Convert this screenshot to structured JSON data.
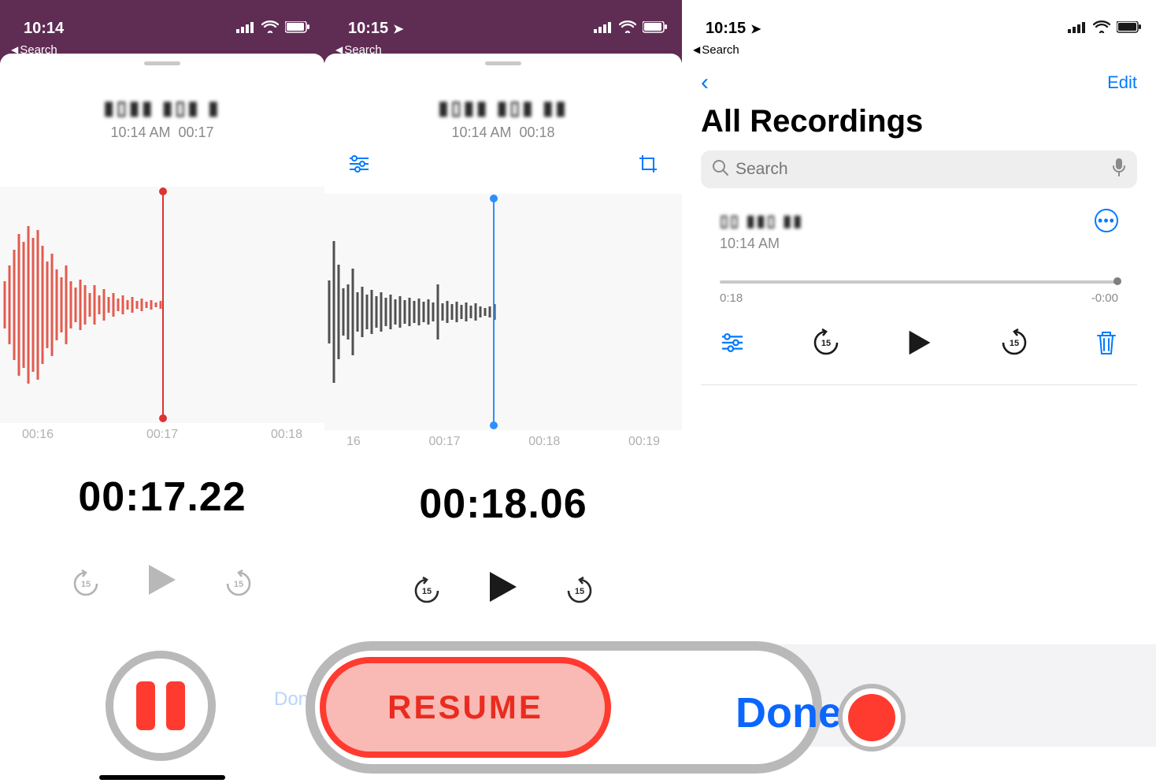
{
  "screen1": {
    "statusbar": {
      "time": "10:14"
    },
    "search_back": "Search",
    "rec_time": "10:14 AM",
    "rec_len": "00:17",
    "timeline": [
      "00:16",
      "00:17",
      "00:18"
    ],
    "elapsed": "00:17.22",
    "done_dim": "Done"
  },
  "screen2": {
    "statusbar": {
      "time": "10:15"
    },
    "search_back": "Search",
    "rec_time": "10:14 AM",
    "rec_len": "00:18",
    "timeline": [
      "16",
      "00:17",
      "00:18",
      "00:19"
    ],
    "elapsed": "00:18.06",
    "resume_label": "RESUME"
  },
  "screen3": {
    "statusbar": {
      "time": "10:15"
    },
    "search_back": "Search",
    "edit": "Edit",
    "title": "All Recordings",
    "search_placeholder": "Search",
    "item": {
      "time": "10:14 AM",
      "pos_left": "0:18",
      "pos_right": "-0:00"
    },
    "done": "Done",
    "skip_seconds": "15"
  },
  "skip_seconds": "15"
}
